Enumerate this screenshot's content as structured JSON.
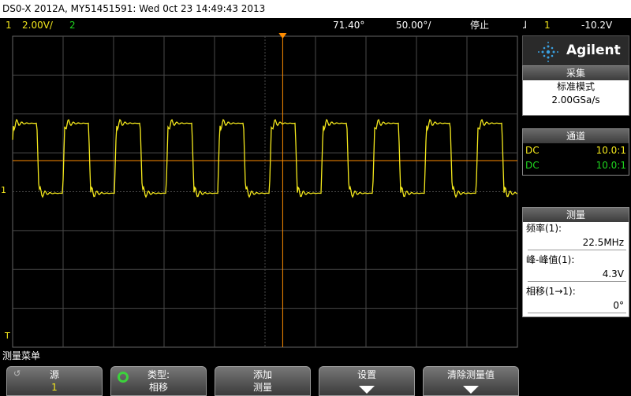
{
  "window": {
    "title": "DS0-X 2012A, MY51451591: Wed 0ct 23 14:49:43 2013"
  },
  "status": {
    "ch1_num": "1",
    "ch1_scale": "2.00V/",
    "ch2_num": "2",
    "timebase": "71.40°",
    "timescale": "50.00°/",
    "run_state": "停止",
    "trigger_symbol": "ɺ",
    "trigger_source": "1",
    "trigger_level": "-10.2V"
  },
  "brand": {
    "name": "Agilent"
  },
  "acquisition": {
    "header": "采集",
    "mode": "标准模式",
    "rate": "2.00GSa/s"
  },
  "channels": {
    "header": "通道",
    "rows": [
      {
        "coupling": "DC",
        "probe": "10.0:1",
        "color": "#f4e81c"
      },
      {
        "coupling": "DC",
        "probe": "10.0:1",
        "color": "#1fd51f"
      }
    ]
  },
  "measurements": {
    "header": "测量",
    "items": [
      {
        "label": "频率(1):",
        "value": "22.5MHz"
      },
      {
        "label": "峰-峰值(1):",
        "value": "4.3V"
      },
      {
        "label": "相移(1→1):",
        "value": "0°"
      }
    ]
  },
  "marker": {
    "ch1_ground": "1",
    "trigger_t": "T"
  },
  "menu": {
    "title": "测量菜单",
    "softkeys": [
      {
        "line1": "源",
        "line2": "1"
      },
      {
        "line1": "类型:",
        "line2": "相移"
      },
      {
        "line1": "添加",
        "line2": "测量"
      },
      {
        "line1": "设置",
        "line2": ""
      },
      {
        "line1": "清除测量值",
        "line2": ""
      }
    ]
  },
  "colors": {
    "ch1": "#f4e81c",
    "ch2": "#1fd51f",
    "trigger_cursor": "#ff8c00",
    "grid": "#4a4a4a"
  }
}
